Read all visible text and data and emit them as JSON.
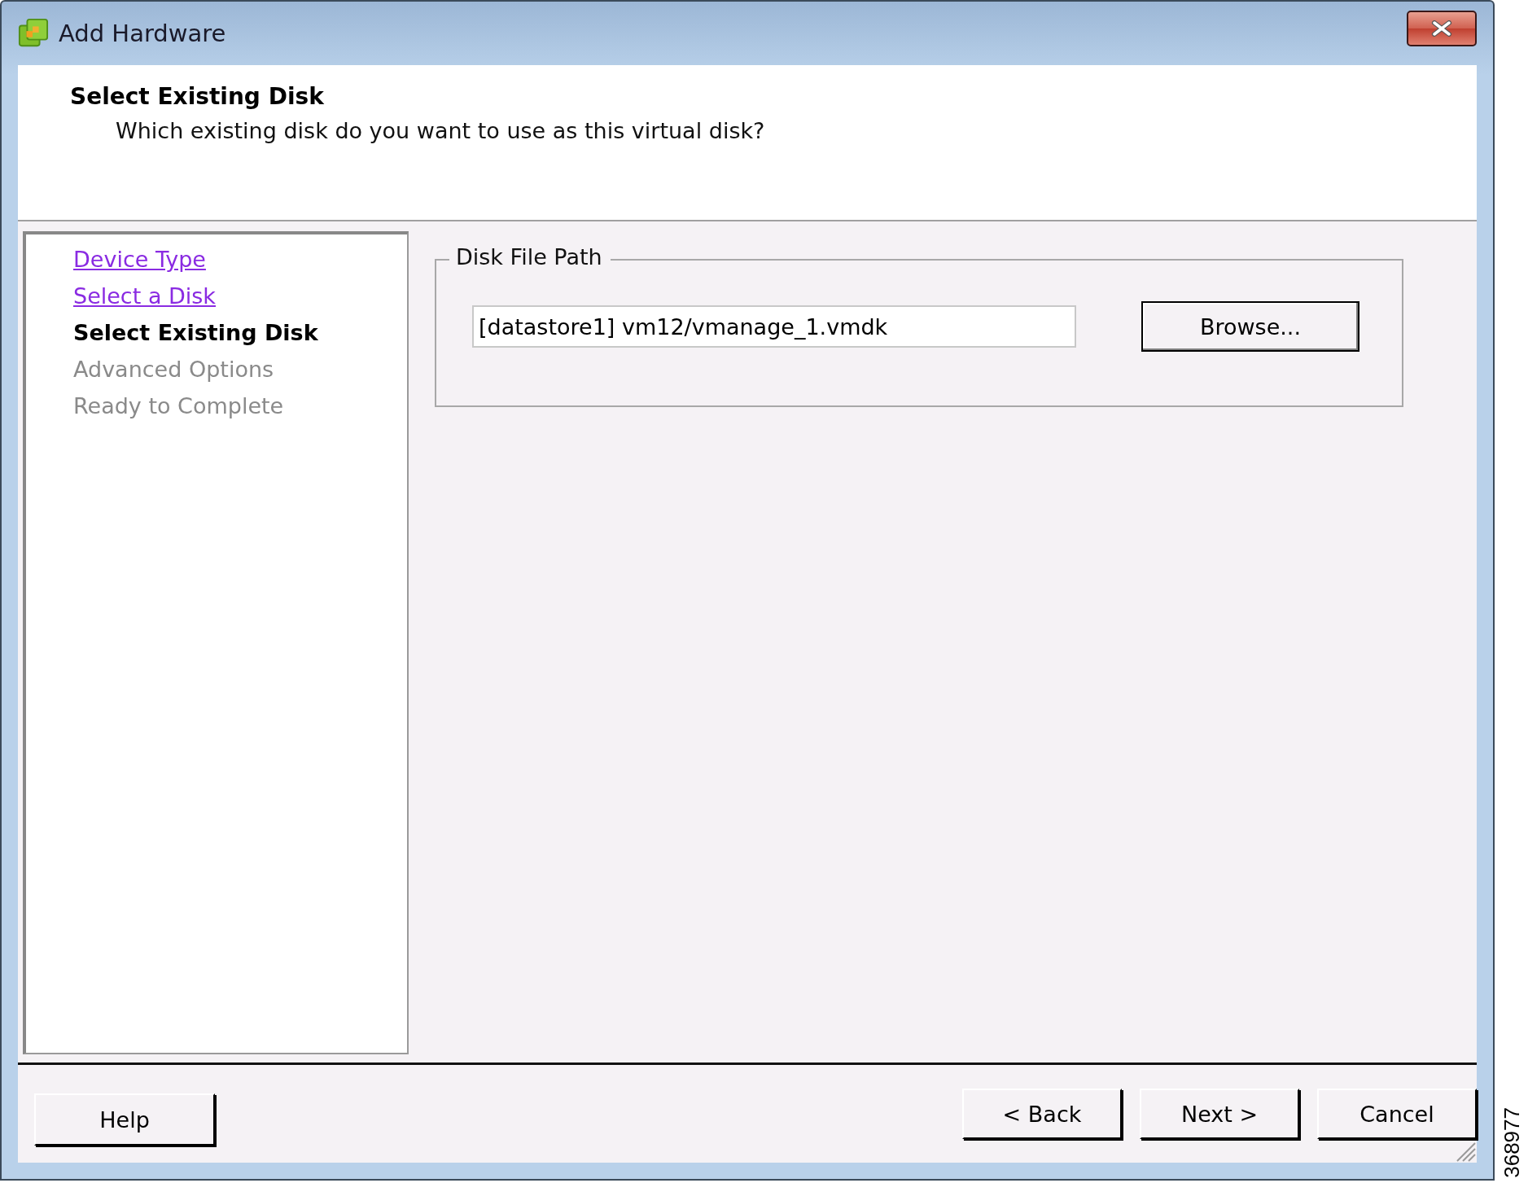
{
  "window": {
    "title": "Add Hardware"
  },
  "header": {
    "title": "Select Existing Disk",
    "subtitle": "Which existing disk do you want to use as this virtual disk?"
  },
  "steps": [
    {
      "label": "Device Type",
      "selected": false,
      "disabled": false
    },
    {
      "label": "Select a Disk",
      "selected": false,
      "disabled": false
    },
    {
      "label": "Select Existing Disk",
      "selected": true,
      "disabled": false
    },
    {
      "label": "Advanced Options",
      "selected": false,
      "disabled": true
    },
    {
      "label": "Ready to Complete",
      "selected": false,
      "disabled": true
    }
  ],
  "disk_file_path": {
    "legend": "Disk File Path",
    "value": "[datastore1] vm12/vmanage_1.vmdk",
    "browse_button": "Browse..."
  },
  "buttons": {
    "help": "Help",
    "back": "< Back",
    "next": "Next >",
    "cancel": "Cancel"
  },
  "figure_number": "368977"
}
